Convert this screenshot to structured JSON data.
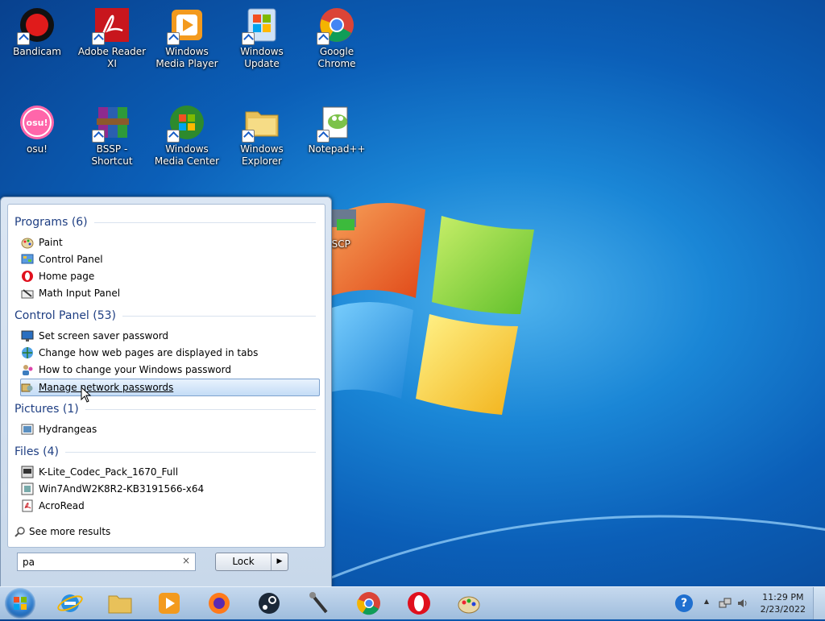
{
  "desktop": {
    "icons": [
      {
        "label": "Bandicam"
      },
      {
        "label": "Adobe Reader XI"
      },
      {
        "label": "Windows Media Player"
      },
      {
        "label": "Windows Update"
      },
      {
        "label": "Google Chrome"
      },
      {
        "label": "osu!"
      },
      {
        "label": "BSSP - Shortcut"
      },
      {
        "label": "Windows Media Center"
      },
      {
        "label": "Windows Explorer"
      },
      {
        "label": "Notepad++"
      },
      {
        "label": "nSCP"
      }
    ],
    "osu_badge": "osu!"
  },
  "start_menu": {
    "groups": {
      "programs": {
        "title": "Programs (6)",
        "items": [
          "Paint",
          "Control Panel",
          "Home page",
          "Math Input Panel"
        ]
      },
      "control_panel": {
        "title": "Control Panel (53)",
        "items": [
          "Set screen saver password",
          "Change how web pages are displayed in tabs",
          "How to change your Windows password",
          "Manage network passwords"
        ]
      },
      "pictures": {
        "title": "Pictures (1)",
        "items": [
          "Hydrangeas"
        ]
      },
      "files": {
        "title": "Files (4)",
        "items": [
          "K-Lite_Codec_Pack_1670_Full",
          "Win7AndW2K8R2-KB3191566-x64",
          "AcroRead"
        ]
      }
    },
    "see_more": "See more results",
    "search": {
      "value": "pa",
      "clear": "×"
    },
    "lock_button": {
      "label": "Lock",
      "arrow": "▶"
    }
  },
  "taskbar": {
    "pinned": [
      "internet-explorer",
      "windows-explorer",
      "windows-media-player",
      "firefox",
      "steam",
      "microphone",
      "google-chrome",
      "opera",
      "paint"
    ],
    "clock": {
      "time": "11:29 PM",
      "date": "2/23/2022"
    },
    "help_glyph": "?",
    "tray_arrow": "▲"
  },
  "colors": {
    "accent": "#1e3e82",
    "selection_border": "#7da2ce"
  }
}
